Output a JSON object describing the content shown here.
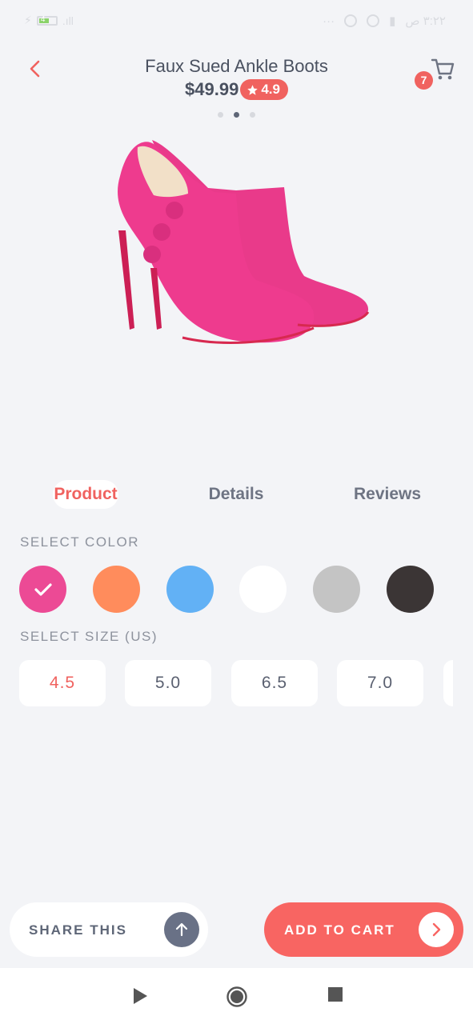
{
  "status_bar": {
    "battery_level": "4",
    "time": "٣:٢٢ ص",
    "dots": "···"
  },
  "header": {
    "title": "Faux Sued Ankle Boots",
    "price": "$49.99",
    "rating": "4.9",
    "cart_count": "7"
  },
  "carousel": {
    "total": 3,
    "active_index": 1
  },
  "product": {
    "color": "#ee3b8e",
    "sole_color": "#cc1f55"
  },
  "tabs": [
    {
      "label": "Product",
      "active": true
    },
    {
      "label": "Details",
      "active": false
    },
    {
      "label": "Reviews",
      "active": false
    }
  ],
  "color_section": {
    "label": "SELECT COLOR",
    "options": [
      {
        "name": "pink",
        "hex": "#ec4a95",
        "selected": true
      },
      {
        "name": "orange",
        "hex": "#ff8c5c",
        "selected": false
      },
      {
        "name": "blue",
        "hex": "#62b1f5",
        "selected": false
      },
      {
        "name": "white",
        "hex": "#ffffff",
        "selected": false
      },
      {
        "name": "grey",
        "hex": "#c4c4c4",
        "selected": false
      },
      {
        "name": "black",
        "hex": "#3b3535",
        "selected": false
      }
    ]
  },
  "size_section": {
    "label": "SELECT SIZE (US)",
    "options": [
      {
        "label": "4.5",
        "selected": true
      },
      {
        "label": "5.0",
        "selected": false
      },
      {
        "label": "6.5",
        "selected": false
      },
      {
        "label": "7.0",
        "selected": false
      }
    ]
  },
  "actions": {
    "share_label": "SHARE THIS",
    "add_to_cart_label": "ADD TO CART"
  },
  "colors": {
    "accent": "#f0625f",
    "background": "#f3f4f7",
    "text": "#4a5160"
  },
  "icons": {
    "back": "chevron-left-icon",
    "cart": "shopping-cart-icon",
    "star": "star-icon",
    "share": "arrow-up-icon",
    "add": "chevron-right-icon",
    "check": "check-icon"
  }
}
